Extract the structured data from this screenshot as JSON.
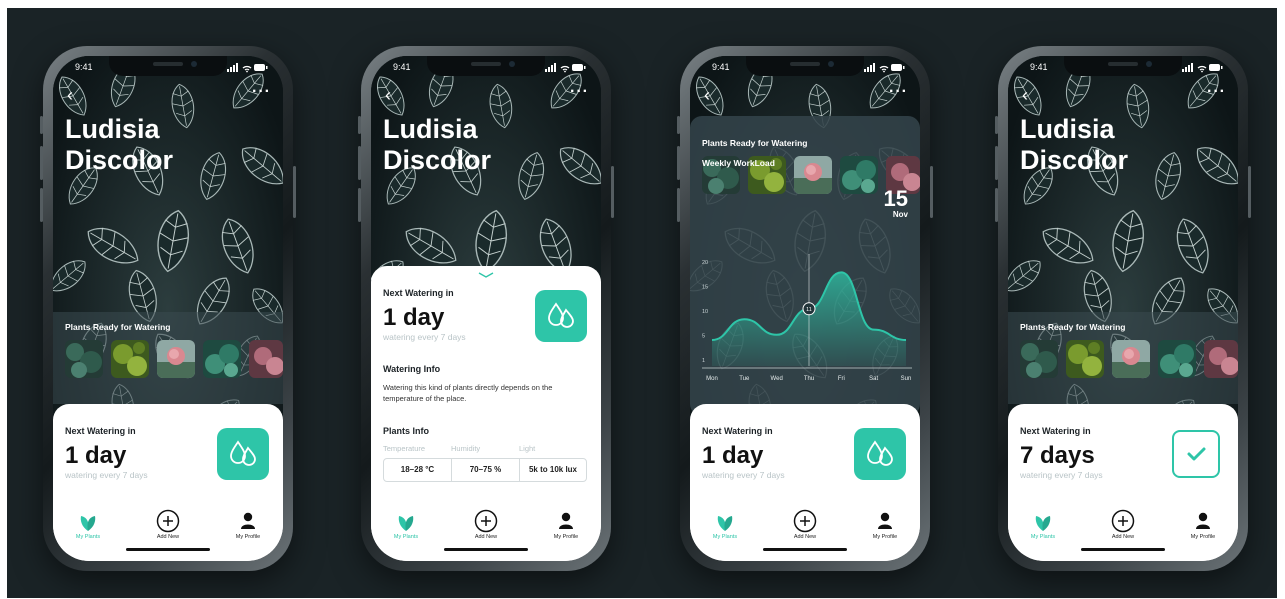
{
  "status": {
    "time": "9:41"
  },
  "plant": {
    "name_line1": "Ludisia",
    "name_line2": "Discolor"
  },
  "ready_section": {
    "title": "Plants Ready for Watering"
  },
  "watering": {
    "label": "Next Watering in",
    "value": "1 day",
    "value_alt": "7 days",
    "subtitle": "watering every 7 days"
  },
  "watering_info": {
    "title": "Watering Info",
    "text": "Watering this kind of plants directly depends on the temperature of the place."
  },
  "plants_info": {
    "title": "Plants Info",
    "headers": [
      "Temperature",
      "Humidity",
      "Light"
    ],
    "values": [
      "18–28 °C",
      "70–75 %",
      "5k to 10k lux"
    ]
  },
  "tabbar": {
    "items": [
      {
        "label": "My Plants",
        "icon": "leaf-icon"
      },
      {
        "label": "Add New",
        "icon": "plus-circle-icon"
      },
      {
        "label": "My Profile",
        "icon": "user-icon"
      }
    ]
  },
  "workload": {
    "title": "Weekly WorkLoad",
    "highlight_day": "15",
    "highlight_month": "Nov",
    "marker_value": "11"
  },
  "colors": {
    "accent": "#2ec5a8",
    "background": "#1a2326"
  },
  "chart_data": {
    "type": "area",
    "title": "Weekly WorkLoad",
    "categories": [
      "Mon",
      "Tue",
      "Wed",
      "Thu",
      "Fri",
      "Sat",
      "Sun"
    ],
    "y_ticks": [
      "20",
      "15",
      "10",
      "5",
      "1"
    ],
    "series": [
      {
        "values": [
          5,
          9,
          6,
          11,
          18,
          7,
          5
        ]
      }
    ],
    "ylim": [
      0,
      20
    ],
    "grid": false,
    "highlight": {
      "category": "Thu",
      "value": 11
    }
  }
}
